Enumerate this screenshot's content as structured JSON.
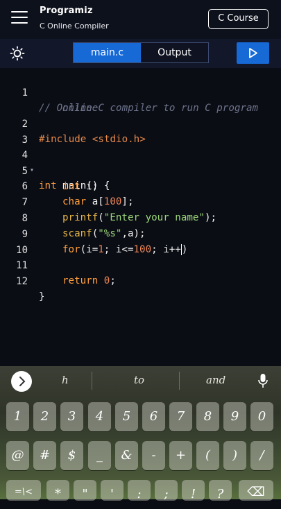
{
  "header": {
    "brand_name": "Programiz",
    "brand_sub": "C Online Compiler",
    "course_button": "C Course"
  },
  "toolbar": {
    "tabs": [
      {
        "label": "main.c",
        "active": true
      },
      {
        "label": "Output",
        "active": false
      }
    ],
    "theme_icon": "sun-icon",
    "run_icon": "play-icon"
  },
  "editor": {
    "line_numbers": [
      "1",
      "",
      "2",
      "3",
      "4",
      "5",
      "6",
      "7",
      "8",
      "9",
      "10",
      "11",
      "12"
    ],
    "lines": {
      "l1a": "// Online C compiler to run C program",
      "l1b": "online",
      "l2": "#include <stdio.h>",
      "l4_kw": "int",
      "l4_rest": " main() {",
      "l5_kw": "int",
      "l5_rest": " i;",
      "l6_kw": "char",
      "l6_a": " a[",
      "l6_num": "100",
      "l6_b": "];",
      "l7_fn": "printf",
      "l7_a": "(",
      "l7_str": "\"Enter your name\"",
      "l7_b": ");",
      "l8_fn": "scanf",
      "l8_a": "(",
      "l8_str": "\"%s\"",
      "l8_b": ",a);",
      "l9_kw": "for",
      "l9_a": "(i=",
      "l9_n1": "1",
      "l9_b": "; i<=",
      "l9_n2": "100",
      "l9_c": "; i++",
      "l9_d": ")",
      "l11_kw": "return",
      "l11_sp": " ",
      "l11_num": "0",
      "l11_end": ";",
      "l12": "}"
    }
  },
  "keyboard": {
    "suggestions": [
      "h",
      "to",
      "and"
    ],
    "row1": [
      "1",
      "2",
      "3",
      "4",
      "5",
      "6",
      "7",
      "8",
      "9",
      "0"
    ],
    "row2": [
      "@",
      "#",
      "$",
      "_",
      "&",
      "-",
      "+",
      "(",
      ")",
      "/"
    ],
    "row3": [
      "=\\<",
      "*",
      "\"",
      "'",
      ":",
      ";",
      "!",
      "?",
      "⌫"
    ]
  },
  "colors": {
    "accent": "#1769d6",
    "background": "#0b0d15",
    "comment": "#6c7289",
    "keyword": "#ff9e3d",
    "string": "#9bd67a",
    "number": "#ee8757"
  }
}
